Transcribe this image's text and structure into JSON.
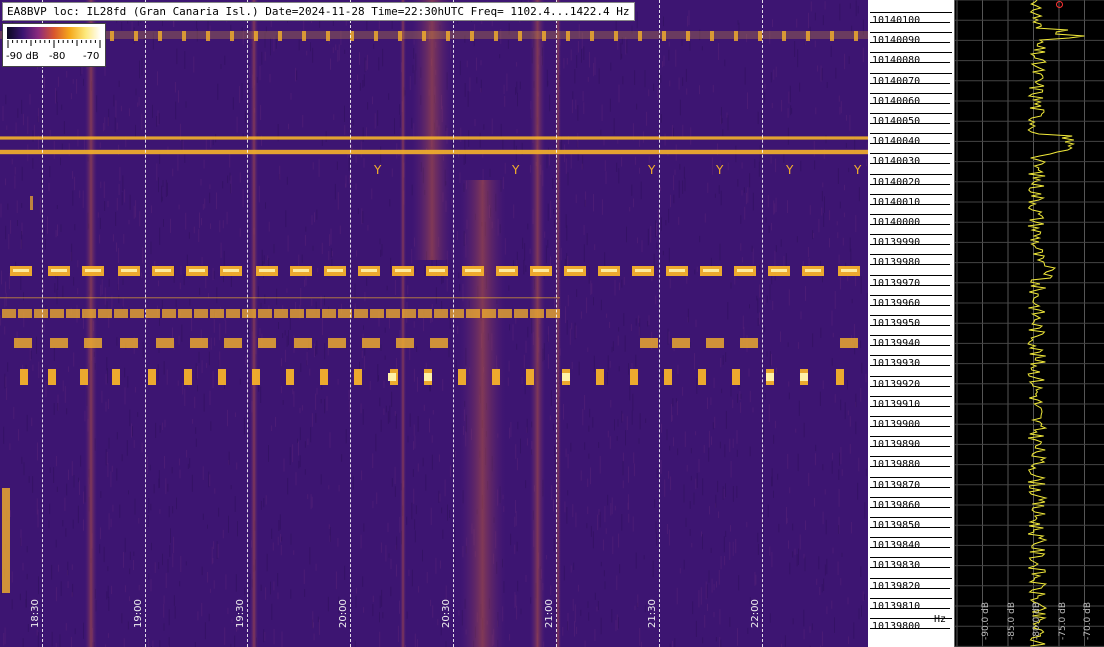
{
  "title": "EA8BVP loc: IL28fd (Gran Canaria Isl.) Date=2024-11-28 Time=22:30hUTC Freq= 1102.4...1422.4 Hz",
  "legend": {
    "labels": [
      "-90 dB",
      "-80",
      "-70"
    ]
  },
  "time_axis": {
    "labels": [
      "18:30",
      "19:00",
      "19:30",
      "20:00",
      "20:30",
      "21:00",
      "21:30",
      "22:00"
    ]
  },
  "freq_axis": {
    "labels": [
      "10140100",
      "10140090",
      "10140080",
      "10140070",
      "10140060",
      "10140050",
      "10140040",
      "10140030",
      "10140020",
      "10140010",
      "10140000",
      "10139990",
      "10139980",
      "10139970",
      "10139960",
      "10139950",
      "10139940",
      "10139930",
      "10139920",
      "10139910",
      "10139900",
      "10139890",
      "10139880",
      "10139870",
      "10139860",
      "10139850",
      "10139840",
      "10139830",
      "10139820",
      "10139810",
      "10139800"
    ],
    "unit": "Hz"
  },
  "spectrum": {
    "db_labels": [
      "-90.0 dB",
      "-85.0 dB",
      "-80.0 dB",
      "-75.0 dB",
      "-70.0 dB"
    ]
  },
  "colors": {
    "background": "#3d1572",
    "signal": "#f5b12a",
    "hot": "#fff2a8",
    "trace": "#f2ea3a"
  }
}
